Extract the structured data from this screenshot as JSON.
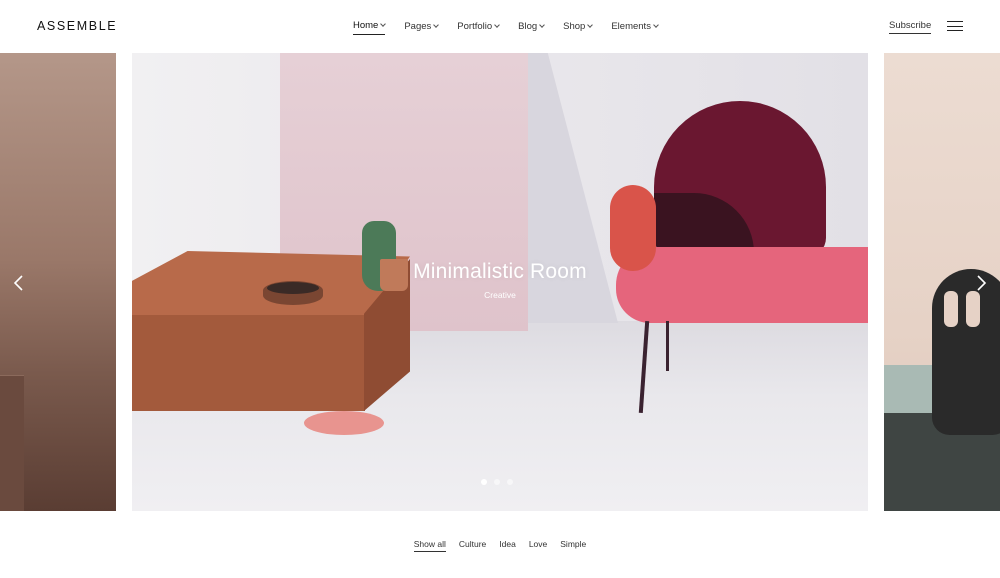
{
  "header": {
    "logo": "ASSEMBLE",
    "nav": [
      {
        "label": "Home",
        "active": true
      },
      {
        "label": "Pages",
        "active": false
      },
      {
        "label": "Portfolio",
        "active": false
      },
      {
        "label": "Blog",
        "active": false
      },
      {
        "label": "Shop",
        "active": false
      },
      {
        "label": "Elements",
        "active": false
      }
    ],
    "subscribe": "Subscribe",
    "menu_icon": "hamburger-icon"
  },
  "slider": {
    "title": "Minimalistic Room",
    "subtitle": "Creative",
    "slide_count": 3,
    "active_slide": 1,
    "prev_icon": "chevron-left-icon",
    "next_icon": "chevron-right-icon"
  },
  "filters": [
    {
      "label": "Show all",
      "active": true
    },
    {
      "label": "Culture",
      "active": false
    },
    {
      "label": "Idea",
      "active": false
    },
    {
      "label": "Love",
      "active": false
    },
    {
      "label": "Simple",
      "active": false
    }
  ],
  "colors": {
    "seat": "#e5657c",
    "chair_back": "#6a1730",
    "box": "#a35a3c",
    "text_dark": "#222222"
  }
}
